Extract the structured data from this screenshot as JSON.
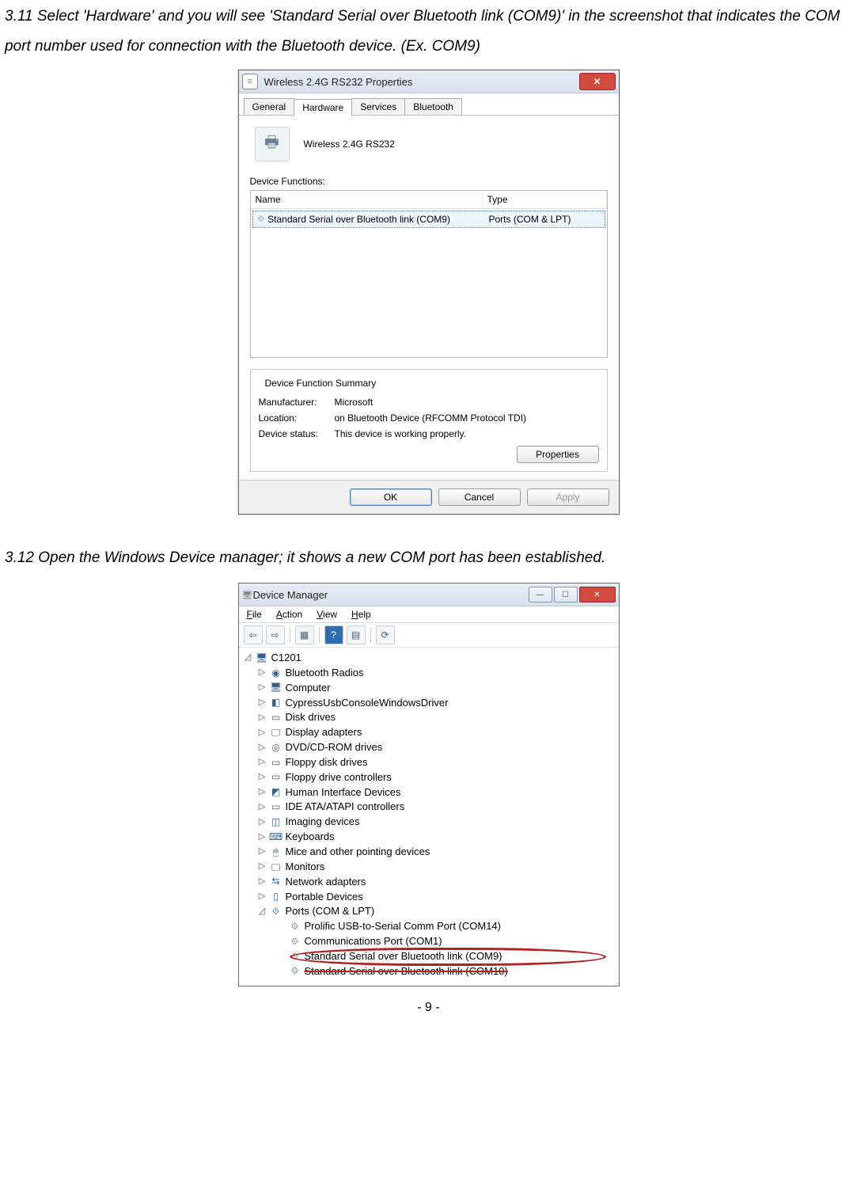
{
  "doc": {
    "step311": "3.11 Select 'Hardware' and you will see 'Standard Serial over Bluetooth link (COM9)' in the screenshot that indicates the COM port number used for connection with the Bluetooth device. (Ex. COM9)",
    "step312": "3.12 Open the Windows Device manager; it shows a new COM port has been established.",
    "pagenum": "- 9 -"
  },
  "propDialog": {
    "title": "Wireless 2.4G RS232 Properties",
    "tabs": {
      "general": "General",
      "hardware": "Hardware",
      "services": "Services",
      "bluetooth": "Bluetooth"
    },
    "deviceName": "Wireless 2.4G RS232",
    "functionsLabel": "Device Functions:",
    "cols": {
      "name": "Name",
      "type": "Type"
    },
    "row": {
      "name": "Standard Serial over Bluetooth link (COM9)",
      "type": "Ports (COM & LPT)"
    },
    "summaryTitle": "Device Function Summary",
    "summary": {
      "manufacturerK": "Manufacturer:",
      "manufacturerV": "Microsoft",
      "locationK": "Location:",
      "locationV": "on Bluetooth Device (RFCOMM Protocol TDI)",
      "statusK": "Device status:",
      "statusV": "This device is working properly."
    },
    "propertiesBtn": "Properties",
    "ok": "OK",
    "cancel": "Cancel",
    "apply": "Apply"
  },
  "devmgr": {
    "title": "Device Manager",
    "menu": {
      "file": "File",
      "action": "Action",
      "view": "View",
      "help": "Help"
    },
    "root": "C1201",
    "items": [
      "Bluetooth Radios",
      "Computer",
      "CypressUsbConsoleWindowsDriver",
      "Disk drives",
      "Display adapters",
      "DVD/CD-ROM drives",
      "Floppy disk drives",
      "Floppy drive controllers",
      "Human Interface Devices",
      "IDE ATA/ATAPI controllers",
      "Imaging devices",
      "Keyboards",
      "Mice and other pointing devices",
      "Monitors",
      "Network adapters",
      "Portable Devices"
    ],
    "portsLabel": "Ports (COM & LPT)",
    "ports": {
      "p1": "Prolific USB-to-Serial Comm Port (COM14)",
      "p2": "Communications Port (COM1)",
      "p3": "Standard Serial over Bluetooth link (COM9)",
      "p4": "Standard Serial over Bluetooth link (COM10)"
    }
  }
}
